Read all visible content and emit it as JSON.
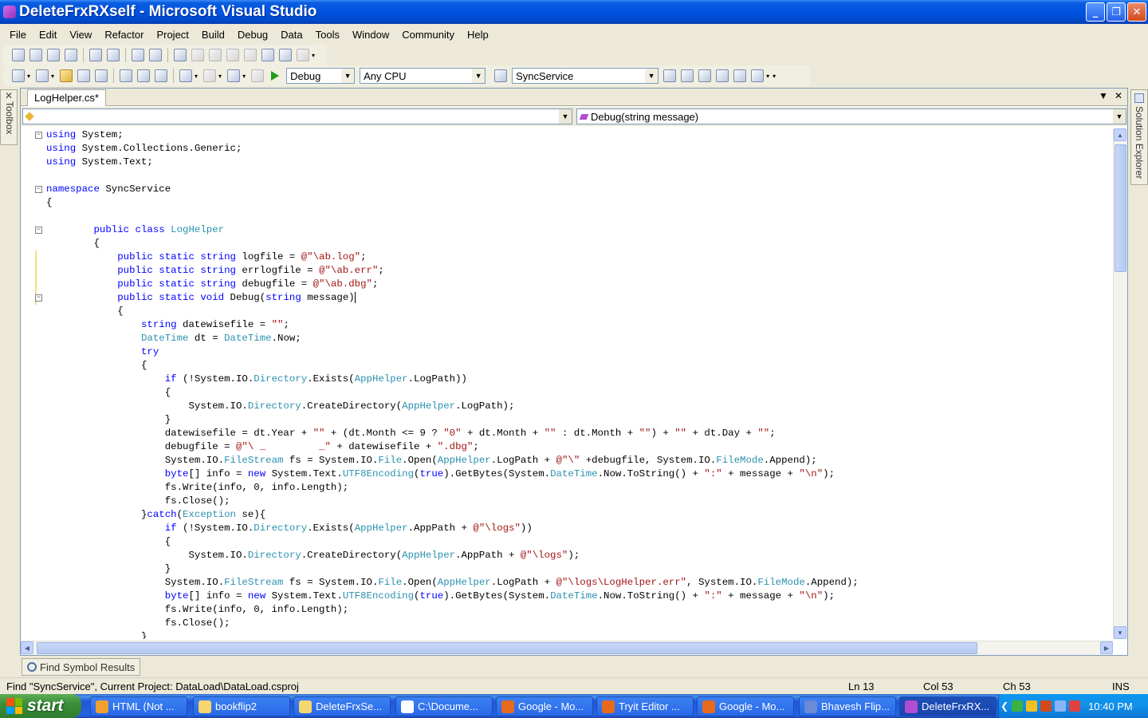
{
  "window": {
    "title": "DeleteFrxRXself - Microsoft Visual Studio",
    "controls": [
      "_",
      "❐",
      "✕"
    ]
  },
  "menu": [
    "File",
    "Edit",
    "View",
    "Refactor",
    "Project",
    "Build",
    "Debug",
    "Data",
    "Tools",
    "Window",
    "Community",
    "Help"
  ],
  "toolbar": {
    "configuration": "Debug",
    "platform": "Any CPU",
    "startup_project": "SyncService"
  },
  "side_panels": {
    "left": "Toolbox",
    "right": "Solution Explorer"
  },
  "editor": {
    "tab_label": "LogHelper.cs*",
    "type_combo": "",
    "member_combo": "Debug(string message)",
    "lines": [
      [
        [
          "kw",
          "using"
        ],
        [
          "t",
          " System;"
        ]
      ],
      [
        [
          "kw",
          "using"
        ],
        [
          "t",
          " System.Collections.Generic;"
        ]
      ],
      [
        [
          "kw",
          "using"
        ],
        [
          "t",
          " System.Text;"
        ]
      ],
      [],
      [
        [
          "kw",
          "namespace"
        ],
        [
          "t",
          " SyncService"
        ]
      ],
      [
        [
          "t",
          "{"
        ]
      ],
      [],
      [
        [
          "t",
          "        "
        ],
        [
          "kw",
          "public class "
        ],
        [
          "ty",
          "LogHelper"
        ]
      ],
      [
        [
          "t",
          "        {"
        ]
      ],
      [
        [
          "t",
          "            "
        ],
        [
          "kw",
          "public static string"
        ],
        [
          "t",
          " logfile = "
        ],
        [
          "str",
          "@\"\\ab.log\""
        ],
        [
          "t",
          ";"
        ]
      ],
      [
        [
          "t",
          "            "
        ],
        [
          "kw",
          "public static string"
        ],
        [
          "t",
          " errlogfile = "
        ],
        [
          "str",
          "@\"\\ab.err\""
        ],
        [
          "t",
          ";"
        ]
      ],
      [
        [
          "t",
          "            "
        ],
        [
          "kw",
          "public static string"
        ],
        [
          "t",
          " debugfile = "
        ],
        [
          "str",
          "@\"\\ab.dbg\""
        ],
        [
          "t",
          ";"
        ]
      ],
      [
        [
          "t",
          "            "
        ],
        [
          "kw",
          "public static void"
        ],
        [
          "t",
          " Debug("
        ],
        [
          "kw",
          "string"
        ],
        [
          "t",
          " message)"
        ]
      ],
      [
        [
          "t",
          "            {"
        ]
      ],
      [
        [
          "t",
          "                "
        ],
        [
          "kw",
          "string"
        ],
        [
          "t",
          " datewisefile = "
        ],
        [
          "str",
          "\"\""
        ],
        [
          "t",
          ";"
        ]
      ],
      [
        [
          "t",
          "                "
        ],
        [
          "ty",
          "DateTime"
        ],
        [
          "t",
          " dt = "
        ],
        [
          "ty",
          "DateTime"
        ],
        [
          "t",
          ".Now;"
        ]
      ],
      [
        [
          "t",
          "                "
        ],
        [
          "kw",
          "try"
        ]
      ],
      [
        [
          "t",
          "                {"
        ]
      ],
      [
        [
          "t",
          "                    "
        ],
        [
          "kw",
          "if"
        ],
        [
          "t",
          " (!System.IO."
        ],
        [
          "ty",
          "Directory"
        ],
        [
          "t",
          ".Exists("
        ],
        [
          "ty",
          "AppHelper"
        ],
        [
          "t",
          ".LogPath))"
        ]
      ],
      [
        [
          "t",
          "                    {"
        ]
      ],
      [
        [
          "t",
          "                        System.IO."
        ],
        [
          "ty",
          "Directory"
        ],
        [
          "t",
          ".CreateDirectory("
        ],
        [
          "ty",
          "AppHelper"
        ],
        [
          "t",
          ".LogPath);"
        ]
      ],
      [
        [
          "t",
          "                    }"
        ]
      ],
      [
        [
          "t",
          "                    datewisefile = dt.Year + "
        ],
        [
          "str",
          "\"\""
        ],
        [
          "t",
          " + (dt.Month <= 9 ? "
        ],
        [
          "str",
          "\"0\""
        ],
        [
          "t",
          " + dt.Month + "
        ],
        [
          "str",
          "\"\""
        ],
        [
          "t",
          " : dt.Month + "
        ],
        [
          "str",
          "\"\""
        ],
        [
          "t",
          ") + "
        ],
        [
          "str",
          "\"\""
        ],
        [
          "t",
          " + dt.Day + "
        ],
        [
          "str",
          "\"\""
        ],
        [
          "t",
          ";"
        ]
      ],
      [
        [
          "t",
          "                    debugfile = "
        ],
        [
          "str",
          "@\"\\ _         _\""
        ],
        [
          "t",
          " + datewisefile + "
        ],
        [
          "str",
          "\".dbg\""
        ],
        [
          "t",
          ";"
        ]
      ],
      [
        [
          "t",
          "                    System.IO."
        ],
        [
          "ty",
          "FileStream"
        ],
        [
          "t",
          " fs = System.IO."
        ],
        [
          "ty",
          "File"
        ],
        [
          "t",
          ".Open("
        ],
        [
          "ty",
          "AppHelper"
        ],
        [
          "t",
          ".LogPath + "
        ],
        [
          "str",
          "@\"\\\""
        ],
        [
          "t",
          " +debugfile, System.IO."
        ],
        [
          "ty",
          "FileMode"
        ],
        [
          "t",
          ".Append);"
        ]
      ],
      [
        [
          "t",
          "                    "
        ],
        [
          "kw",
          "byte"
        ],
        [
          "t",
          "[] info = "
        ],
        [
          "kw",
          "new"
        ],
        [
          "t",
          " System.Text."
        ],
        [
          "ty",
          "UTF8Encoding"
        ],
        [
          "t",
          "("
        ],
        [
          "kw",
          "true"
        ],
        [
          "t",
          ").GetBytes(System."
        ],
        [
          "ty",
          "DateTime"
        ],
        [
          "t",
          ".Now.ToString() + "
        ],
        [
          "str",
          "\":\""
        ],
        [
          "t",
          " + message + "
        ],
        [
          "str",
          "\"\\n\""
        ],
        [
          "t",
          ");"
        ]
      ],
      [
        [
          "t",
          "                    fs.Write(info, 0, info.Length);"
        ]
      ],
      [
        [
          "t",
          "                    fs.Close();"
        ]
      ],
      [
        [
          "t",
          "                }"
        ],
        [
          "kw",
          "catch"
        ],
        [
          "t",
          "("
        ],
        [
          "ty",
          "Exception"
        ],
        [
          "t",
          " se){"
        ]
      ],
      [
        [
          "t",
          "                    "
        ],
        [
          "kw",
          "if"
        ],
        [
          "t",
          " (!System.IO."
        ],
        [
          "ty",
          "Directory"
        ],
        [
          "t",
          ".Exists("
        ],
        [
          "ty",
          "AppHelper"
        ],
        [
          "t",
          ".AppPath + "
        ],
        [
          "str",
          "@\"\\logs\""
        ],
        [
          "t",
          "))"
        ]
      ],
      [
        [
          "t",
          "                    {"
        ]
      ],
      [
        [
          "t",
          "                        System.IO."
        ],
        [
          "ty",
          "Directory"
        ],
        [
          "t",
          ".CreateDirectory("
        ],
        [
          "ty",
          "AppHelper"
        ],
        [
          "t",
          ".AppPath + "
        ],
        [
          "str",
          "@\"\\logs\""
        ],
        [
          "t",
          ");"
        ]
      ],
      [
        [
          "t",
          "                    }"
        ]
      ],
      [
        [
          "t",
          "                    System.IO."
        ],
        [
          "ty",
          "FileStream"
        ],
        [
          "t",
          " fs = System.IO."
        ],
        [
          "ty",
          "File"
        ],
        [
          "t",
          ".Open("
        ],
        [
          "ty",
          "AppHelper"
        ],
        [
          "t",
          ".LogPath + "
        ],
        [
          "str",
          "@\"\\logs\\LogHelper.err\""
        ],
        [
          "t",
          ", System.IO."
        ],
        [
          "ty",
          "FileMode"
        ],
        [
          "t",
          ".Append);"
        ]
      ],
      [
        [
          "t",
          "                    "
        ],
        [
          "kw",
          "byte"
        ],
        [
          "t",
          "[] info = "
        ],
        [
          "kw",
          "new"
        ],
        [
          "t",
          " System.Text."
        ],
        [
          "ty",
          "UTF8Encoding"
        ],
        [
          "t",
          "("
        ],
        [
          "kw",
          "true"
        ],
        [
          "t",
          ").GetBytes(System."
        ],
        [
          "ty",
          "DateTime"
        ],
        [
          "t",
          ".Now.ToString() + "
        ],
        [
          "str",
          "\":\""
        ],
        [
          "t",
          " + message + "
        ],
        [
          "str",
          "\"\\n\""
        ],
        [
          "t",
          ");"
        ]
      ],
      [
        [
          "t",
          "                    fs.Write(info, 0, info.Length);"
        ]
      ],
      [
        [
          "t",
          "                    fs.Close();"
        ]
      ],
      [
        [
          "t",
          "                }"
        ]
      ]
    ]
  },
  "bottom_tab": "Find Symbol Results",
  "status": {
    "message": "Find \"SyncService\", Current Project: DataLoad\\DataLoad.csproj",
    "line": "Ln 13",
    "col": "Col 53",
    "ch": "Ch 53",
    "mode": "INS"
  },
  "taskbar": {
    "start_label": "start",
    "items": [
      {
        "label": "HTML (Not ...",
        "color": "#f0a030"
      },
      {
        "label": "bookflip2",
        "color": "#f5d76e"
      },
      {
        "label": "DeleteFrxSe...",
        "color": "#f5d76e"
      },
      {
        "label": "C:\\Docume...",
        "color": "#ffffff"
      },
      {
        "label": "Google - Mo...",
        "color": "#e86a1c"
      },
      {
        "label": "Tryit Editor ...",
        "color": "#e86a1c"
      },
      {
        "label": "Google - Mo...",
        "color": "#e86a1c"
      },
      {
        "label": "Bhavesh Flip...",
        "color": "#6a8bd6"
      },
      {
        "label": "DeleteFrxRX...",
        "color": "#b04dd0"
      }
    ],
    "clock": "10:40 PM"
  }
}
